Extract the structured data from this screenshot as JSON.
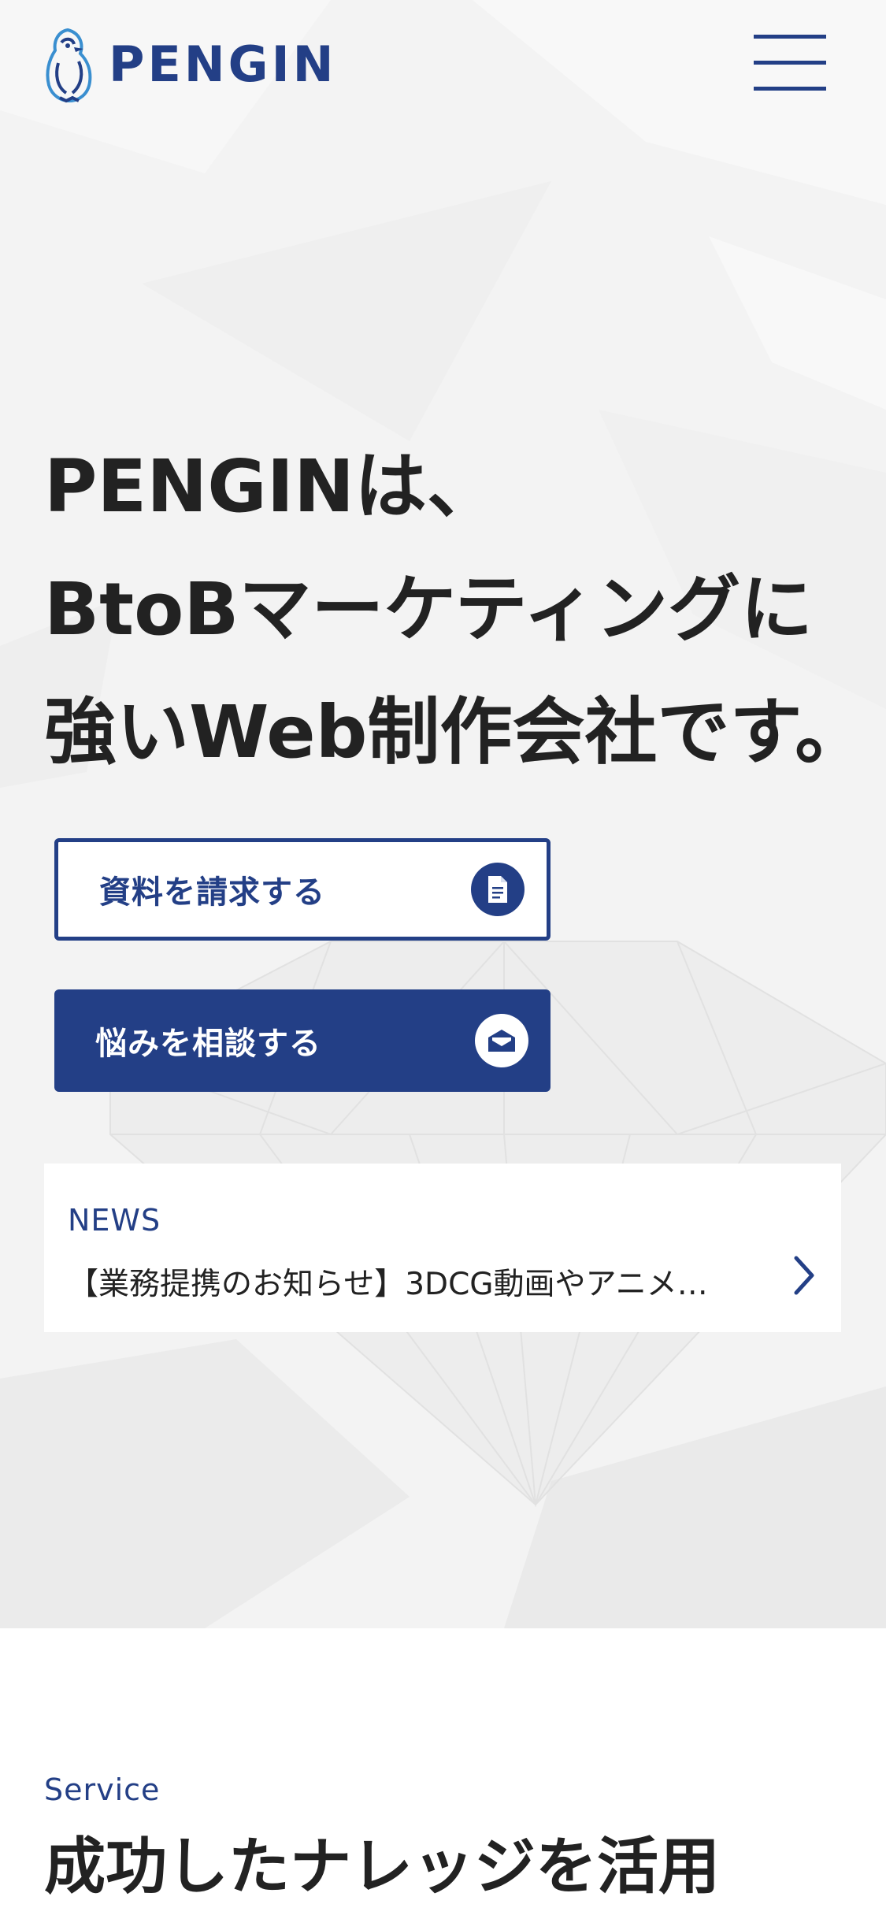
{
  "header": {
    "logo_text": "PENGIN",
    "menu_icon": "hamburger-menu-icon"
  },
  "hero": {
    "headline_lines": [
      "PENGINは、",
      "BtoBマーケティングに",
      "強いWeb制作会社です。"
    ],
    "cta_primary": {
      "label": "資料を請求する",
      "icon": "document-icon"
    },
    "cta_secondary": {
      "label": "悩みを相談する",
      "icon": "mail-icon"
    }
  },
  "news": {
    "label": "NEWS",
    "title": "【業務提携のお知らせ】3DCG動画やアニメ…",
    "icon": "chevron-right-icon"
  },
  "service": {
    "eyebrow": "Service",
    "title": "成功したナレッジを活用"
  },
  "colors": {
    "brand": "#233f86",
    "text": "#222222",
    "hero_background": "#f3f3f3",
    "page_background": "#ffffff"
  }
}
